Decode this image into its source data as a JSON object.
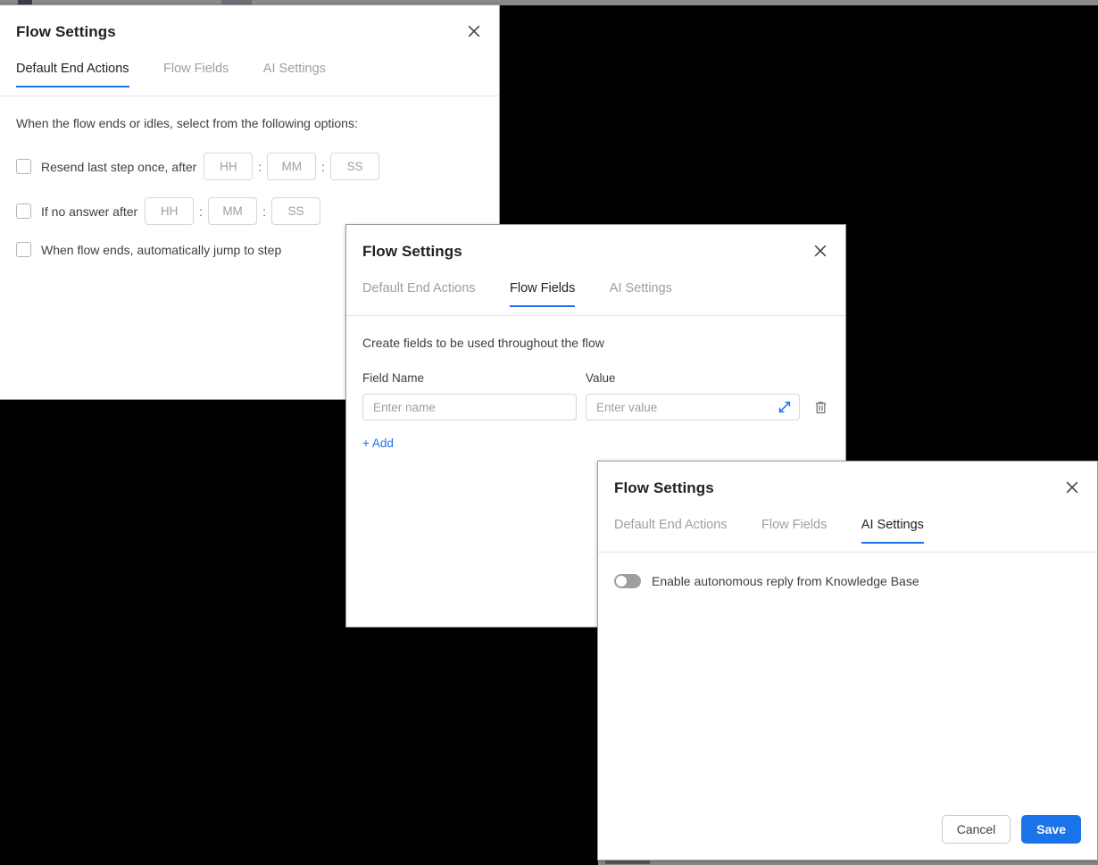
{
  "dialogs": {
    "end_actions": {
      "title": "Flow Settings",
      "close_label": "×",
      "tabs": [
        {
          "label": "Default End Actions",
          "active": true
        },
        {
          "label": "Flow Fields",
          "active": false
        },
        {
          "label": "AI Settings",
          "active": false
        }
      ],
      "description": "When the flow ends or idles, select from the following options:",
      "options": [
        {
          "label": "Resend last step once, after",
          "checked": false,
          "time_inputs": [
            "HH",
            "MM",
            "SS"
          ],
          "separator": ":"
        },
        {
          "label": "If no answer after",
          "checked": false,
          "time_inputs": [
            "HH",
            "MM",
            "SS"
          ],
          "separator": ":"
        },
        {
          "label": "When flow ends, automatically jump to step",
          "checked": false,
          "time_inputs": [],
          "separator": ":"
        }
      ]
    },
    "flow_fields": {
      "title": "Flow Settings",
      "close_label": "×",
      "tabs": [
        {
          "label": "Default End Actions",
          "active": false
        },
        {
          "label": "Flow Fields",
          "active": true
        },
        {
          "label": "AI Settings",
          "active": false
        }
      ],
      "description": "Create fields to be used throughout the flow",
      "column_headers": {
        "name": "Field Name",
        "value": "Value"
      },
      "rows": [
        {
          "name_value": "",
          "name_placeholder": "Enter name",
          "value_value": "",
          "value_placeholder": "Enter value"
        }
      ],
      "add_label": "+ Add"
    },
    "ai_settings": {
      "title": "Flow Settings",
      "close_label": "×",
      "tabs": [
        {
          "label": "Default End Actions",
          "active": false
        },
        {
          "label": "Flow Fields",
          "active": false
        },
        {
          "label": "AI Settings",
          "active": true
        }
      ],
      "toggle": {
        "label": "Enable autonomous reply from Knowledge Base",
        "enabled": false
      },
      "footer": {
        "cancel_label": "Cancel",
        "save_label": "Save"
      }
    }
  },
  "colors": {
    "accent": "#1a73e8",
    "text_primary": "#202124",
    "text_secondary": "#3c4043",
    "text_muted": "#9aa0a6",
    "border": "#d6d6d6",
    "backdrop": "#000000"
  }
}
